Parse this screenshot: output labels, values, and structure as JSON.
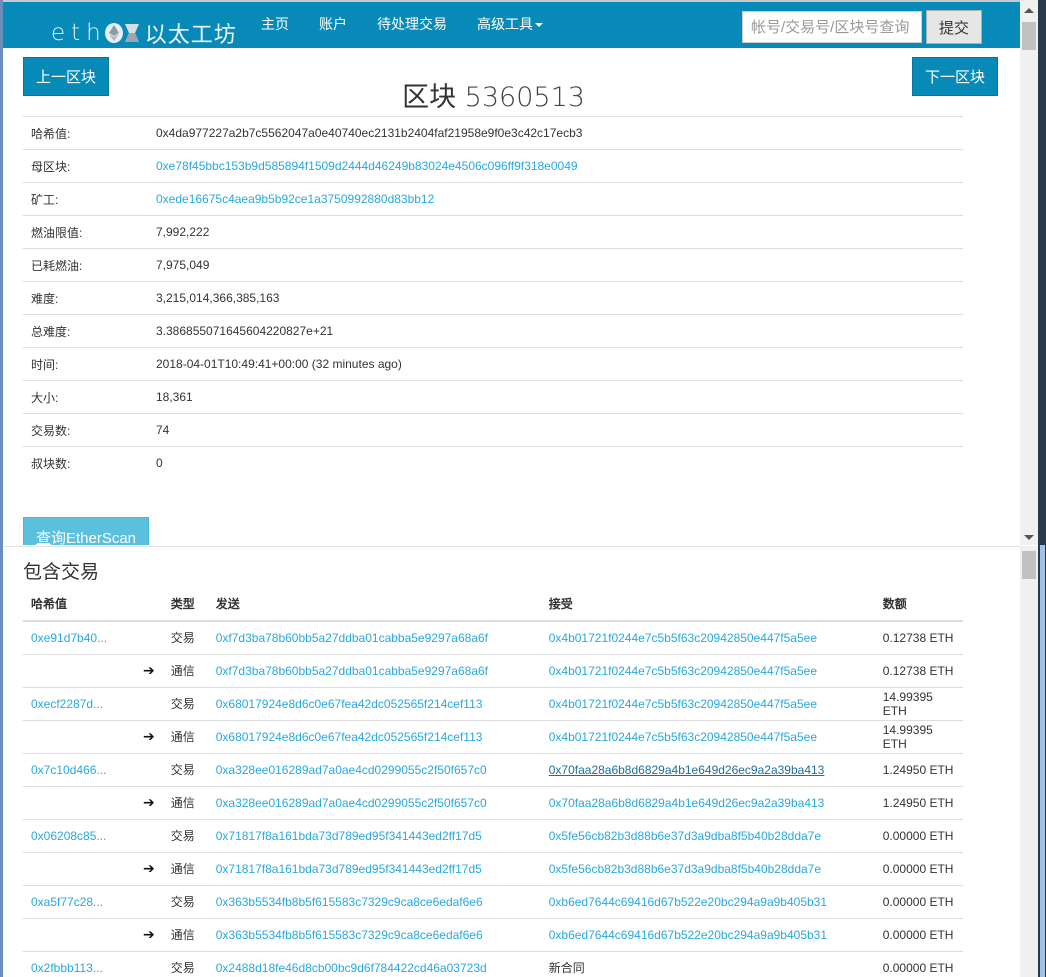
{
  "navbar": {
    "brand_latin": "eth",
    "brand_cn": "以太工坊",
    "links": [
      {
        "label": "主页"
      },
      {
        "label": "账户"
      },
      {
        "label": "待处理交易"
      },
      {
        "label": "高级工具"
      }
    ],
    "search_placeholder": "帐号/交易号/区块号查询",
    "search_value": "",
    "submit_label": "提交"
  },
  "block": {
    "prev_label": "上一区块",
    "next_label": "下一区块",
    "title_prefix": "区块",
    "number": "5360513",
    "fields": [
      {
        "label": "哈希值:",
        "value": "0x4da977227a2b7c5562047a0e40740ec2131b2404faf21958e9f0e3c42c17ecb3",
        "link": false
      },
      {
        "label": "母区块:",
        "value": "0xe78f45bbc153b9d585894f1509d2444d46249b83024e4506c096ff9f318e0049",
        "link": true
      },
      {
        "label": "矿工:",
        "value": "0xede16675c4aea9b5b92ce1a3750992880d83bb12",
        "link": true
      },
      {
        "label": "燃油限值:",
        "value": "7,992,222",
        "link": false
      },
      {
        "label": "已耗燃油:",
        "value": "7,975,049",
        "link": false
      },
      {
        "label": "难度:",
        "value": "3,215,014,366,385,163",
        "link": false
      },
      {
        "label": "总难度:",
        "value": "3.386855071645604220827e+21",
        "link": false
      },
      {
        "label": "时间:",
        "value": "2018-04-01T10:49:41+00:00 (32 minutes ago)",
        "link": false
      },
      {
        "label": "大小:",
        "value": "18,361",
        "link": false
      },
      {
        "label": "交易数:",
        "value": "74",
        "link": false
      },
      {
        "label": "叔块数:",
        "value": "0",
        "link": false
      }
    ],
    "etherscan_prefix": "查",
    "etherscan_rest": "询EtherScan"
  },
  "transactions": {
    "title": "包含交易",
    "headers": {
      "hash": "哈希值",
      "type": "类型",
      "from": "发送",
      "to": "接受",
      "amount": "数额"
    },
    "rows": [
      {
        "hash": "0xe91d7b40...",
        "arrow": false,
        "type": "交易",
        "from": "0xf7d3ba78b60bb5a27ddba01cabba5e9297a68a6f",
        "to": "0x4b01721f0244e7c5b5f63c20942850e447f5a5ee",
        "to_link": true,
        "to_underline": false,
        "amount": "0.12738 ETH"
      },
      {
        "hash": "",
        "arrow": true,
        "type": "通信",
        "from": "0xf7d3ba78b60bb5a27ddba01cabba5e9297a68a6f",
        "to": "0x4b01721f0244e7c5b5f63c20942850e447f5a5ee",
        "to_link": true,
        "to_underline": false,
        "amount": "0.12738 ETH"
      },
      {
        "hash": "0xecf2287d...",
        "arrow": false,
        "type": "交易",
        "from": "0x68017924e8d6c0e67fea42dc052565f214cef113",
        "to": "0x4b01721f0244e7c5b5f63c20942850e447f5a5ee",
        "to_link": true,
        "to_underline": false,
        "amount": "14.99395 ETH"
      },
      {
        "hash": "",
        "arrow": true,
        "type": "通信",
        "from": "0x68017924e8d6c0e67fea42dc052565f214cef113",
        "to": "0x4b01721f0244e7c5b5f63c20942850e447f5a5ee",
        "to_link": true,
        "to_underline": false,
        "amount": "14.99395 ETH"
      },
      {
        "hash": "0x7c10d466...",
        "arrow": false,
        "type": "交易",
        "from": "0xa328ee016289ad7a0ae4cd0299055c2f50f657c0",
        "to": "0x70faa28a6b8d6829a4b1e649d26ec9a2a39ba413",
        "to_link": true,
        "to_underline": true,
        "amount": "1.24950 ETH"
      },
      {
        "hash": "",
        "arrow": true,
        "type": "通信",
        "from": "0xa328ee016289ad7a0ae4cd0299055c2f50f657c0",
        "to": "0x70faa28a6b8d6829a4b1e649d26ec9a2a39ba413",
        "to_link": true,
        "to_underline": false,
        "amount": "1.24950 ETH"
      },
      {
        "hash": "0x06208c85...",
        "arrow": false,
        "type": "交易",
        "from": "0x71817f8a161bda73d789ed95f341443ed2ff17d5",
        "to": "0x5fe56cb82b3d88b6e37d3a9dba8f5b40b28dda7e",
        "to_link": true,
        "to_underline": false,
        "amount": "0.00000 ETH"
      },
      {
        "hash": "",
        "arrow": true,
        "type": "通信",
        "from": "0x71817f8a161bda73d789ed95f341443ed2ff17d5",
        "to": "0x5fe56cb82b3d88b6e37d3a9dba8f5b40b28dda7e",
        "to_link": true,
        "to_underline": false,
        "amount": "0.00000 ETH"
      },
      {
        "hash": "0xa5f77c28...",
        "arrow": false,
        "type": "交易",
        "from": "0x363b5534fb8b5f615583c7329c9ca8ce6edaf6e6",
        "to": "0xb6ed7644c69416d67b522e20bc294a9a9b405b31",
        "to_link": true,
        "to_underline": false,
        "amount": "0.00000 ETH"
      },
      {
        "hash": "",
        "arrow": true,
        "type": "通信",
        "from": "0x363b5534fb8b5f615583c7329c9ca8ce6edaf6e6",
        "to": "0xb6ed7644c69416d67b522e20bc294a9a9b405b31",
        "to_link": true,
        "to_underline": false,
        "amount": "0.00000 ETH"
      },
      {
        "hash": "0x2fbbb113...",
        "arrow": false,
        "type": "交易",
        "from": "0x2488d18fe46d8cb00bc9d6f784422cd46a03723d",
        "to": "新合同",
        "to_link": false,
        "to_underline": false,
        "amount": "0.00000 ETH"
      }
    ]
  },
  "colors": {
    "brand": "#088ab8",
    "link": "#28a8e0",
    "info_button": "#5bc0de"
  }
}
